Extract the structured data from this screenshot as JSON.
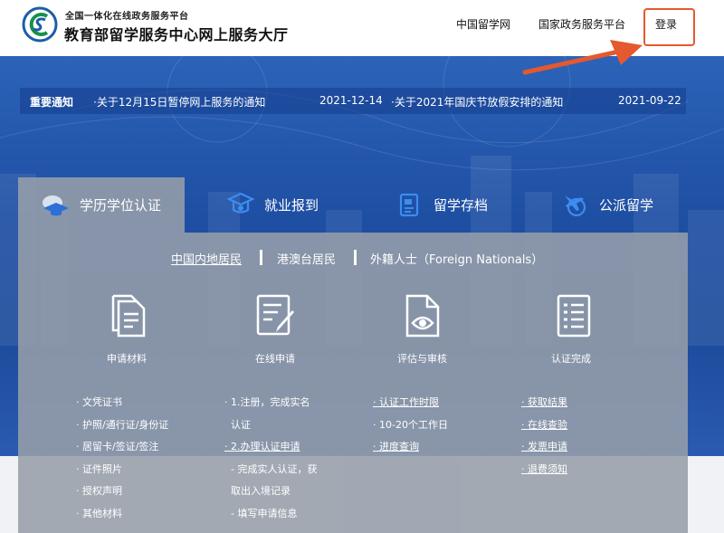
{
  "header": {
    "platform_label": "全国一体化在线政务服务平台",
    "site_title": "教育部留学服务中心网上服务大厅",
    "nav": [
      "中国留学网",
      "国家政务服务平台"
    ],
    "login": "登录",
    "highlight_color": "#e4592e"
  },
  "notice": {
    "label": "重要通知",
    "items": [
      {
        "title": "·关于12月15日暂停网上服务的通知",
        "date": "2021-12-14"
      },
      {
        "title": "·关于2021年国庆节放假安排的通知",
        "date": "2021-09-22"
      }
    ]
  },
  "tabs": [
    {
      "label": "学历学位认证",
      "icon": "graduation-cap-icon"
    },
    {
      "label": "就业报到",
      "icon": "employment-icon"
    },
    {
      "label": "留学存档",
      "icon": "archive-icon"
    },
    {
      "label": "公派留学",
      "icon": "airplane-globe-icon"
    }
  ],
  "subtabs": [
    "中国内地居民",
    "港澳台居民",
    "外籍人士（Foreign Nationals）"
  ],
  "steps": [
    {
      "label": "申请材料",
      "icon": "documents-icon"
    },
    {
      "label": "在线申请",
      "icon": "edit-form-icon"
    },
    {
      "label": "评估与审核",
      "icon": "review-eye-icon"
    },
    {
      "label": "认证完成",
      "icon": "checklist-icon"
    }
  ],
  "columns": [
    [
      "· 文凭证书",
      "· 护照/通行证/身份证",
      "· 居留卡/签证/签注",
      "· 证件照片",
      "· 授权声明",
      "· 其他材料"
    ],
    [
      "· 1.注册，完成实名",
      "认证",
      "· 2.办理认证申请",
      "- 完成实人认证，获",
      "取出入境记录",
      "- 填写申请信息"
    ],
    [
      "· 认证工作时限",
      "· 10-20个工作日",
      "· 进度查询"
    ],
    [
      "· 获取结果",
      "· 在线查验",
      "· 发票申请",
      "· 退费须知"
    ]
  ],
  "colors": {
    "banner": "#1e4fa3",
    "panel": "#969eaa",
    "accent_icon": "#1e5bd6"
  }
}
